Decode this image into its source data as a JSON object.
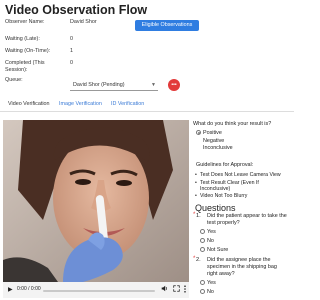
{
  "page": {
    "title": "Video Observation Flow"
  },
  "info": {
    "observer_label": "Observer Name:",
    "observer_value": "David Shor",
    "waiting_late_label": "Waiting (Late):",
    "waiting_late_value": "0",
    "waiting_ontime_label": "Waiting (On-Time):",
    "waiting_ontime_value": "1",
    "completed_label_1": "Completed (This",
    "completed_label_2": "Session):",
    "completed_value": "0",
    "queue_label": "Queue:"
  },
  "eligible_button": {
    "label": "Eligible Observations"
  },
  "queue": {
    "selected": "David Shor (Pending)",
    "badge": "•••"
  },
  "tabs": [
    {
      "label": "Video Verification",
      "active": true
    },
    {
      "label": "Image Verification",
      "active": false
    },
    {
      "label": "ID Verification",
      "active": false
    }
  ],
  "video": {
    "time": "0:00 / 0:00",
    "play_icon": "play-icon",
    "volume_icon": "volume-icon",
    "fullscreen_icon": "fullscreen-icon",
    "more_icon": "more-vertical-icon"
  },
  "result": {
    "question": "What do you think your result is?",
    "options": [
      {
        "label": "Positive",
        "checked": true
      },
      {
        "label": "Negative",
        "checked": false
      },
      {
        "label": "Inconclusive",
        "checked": false
      }
    ]
  },
  "guidelines": {
    "title": "Guidelines for Approval:",
    "items": [
      "Test Does Not Leave Camera View",
      "Test Result Clear (Even If",
      "Inconclusive)",
      "Video Not Too Blurry"
    ]
  },
  "questions": {
    "title": "Questions",
    "q1": {
      "number": "1.",
      "line1": "Did the patient appear to take the",
      "line2": "test properly?",
      "options": [
        "Yes",
        "No",
        "Not Sure"
      ]
    },
    "q2": {
      "number": "2.",
      "line1": "Did the assignee place the",
      "line2": "specimen in the shipping bag",
      "line3": "right away?",
      "options": [
        "Yes",
        "No"
      ]
    }
  }
}
